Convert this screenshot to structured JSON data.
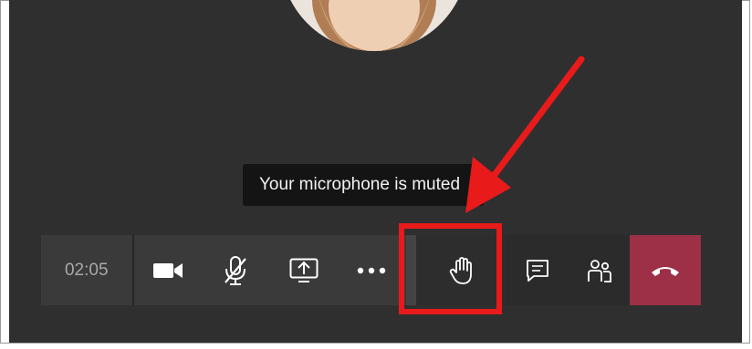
{
  "call": {
    "timer": "02:05",
    "tooltip": "Your microphone is muted"
  },
  "toolbar": {
    "buttons": [
      {
        "name": "camera",
        "icon": "video-camera-icon"
      },
      {
        "name": "microphone",
        "icon": "microphone-muted-icon"
      },
      {
        "name": "share",
        "icon": "share-screen-icon"
      },
      {
        "name": "more",
        "icon": "more-actions-icon"
      },
      {
        "name": "raise-hand",
        "icon": "raise-hand-icon"
      },
      {
        "name": "chat",
        "icon": "chat-icon"
      },
      {
        "name": "participants",
        "icon": "participants-icon"
      },
      {
        "name": "leave",
        "icon": "hang-up-icon"
      }
    ]
  },
  "colors": {
    "stage_background": "#2f2f2f",
    "toolbar_background": "#3a3a3a",
    "leave_button": "#9d3046",
    "annotation": "#e81a1a"
  }
}
